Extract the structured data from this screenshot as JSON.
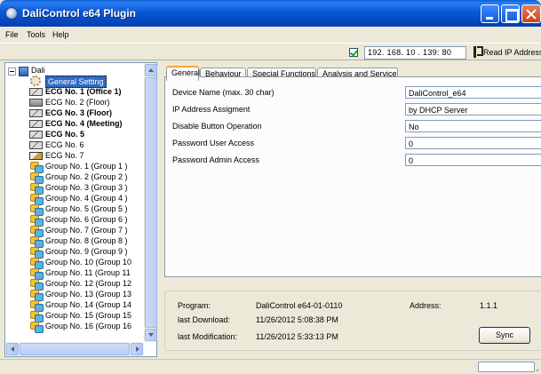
{
  "window": {
    "title": "DaliControl e64 Plugin"
  },
  "menu": {
    "items": [
      "File",
      "Tools",
      "Help"
    ]
  },
  "toolbar": {
    "ip_enabled": true,
    "ip_address": "192. 168. 10 . 139: 80",
    "read_ip_label": "Read IP Address"
  },
  "tree": {
    "root_label": "Dali",
    "items": [
      {
        "label": "General Setting",
        "icon": "gear-icon",
        "selected": true,
        "bold": false
      },
      {
        "label": "ECG No. 1 (Office 1)",
        "icon": "ecg-icon",
        "bold": true
      },
      {
        "label": "ECG No. 2 (Floor)",
        "icon": "ecg-icon",
        "bold": false
      },
      {
        "label": "ECG No. 3 (Floor)",
        "icon": "ecg-icon",
        "bold": true
      },
      {
        "label": "ECG No. 4 (Meeting)",
        "icon": "ecg-icon",
        "bold": true
      },
      {
        "label": "ECG No. 5",
        "icon": "ecg-icon",
        "bold": true
      },
      {
        "label": "ECG No. 6",
        "icon": "ecg-icon",
        "bold": false
      },
      {
        "label": "ECG No. 7",
        "icon": "ecg-warning-icon",
        "bold": false
      },
      {
        "label": "Group No. 1 (Group  1  )",
        "icon": "group-icon",
        "bold": false
      },
      {
        "label": "Group No. 2 (Group  2  )",
        "icon": "group-icon",
        "bold": false
      },
      {
        "label": "Group No. 3 (Group  3  )",
        "icon": "group-icon",
        "bold": false
      },
      {
        "label": "Group No. 4 (Group  4  )",
        "icon": "group-icon",
        "bold": false
      },
      {
        "label": "Group No. 5 (Group  5  )",
        "icon": "group-icon",
        "bold": false
      },
      {
        "label": "Group No. 6 (Group  6  )",
        "icon": "group-icon",
        "bold": false
      },
      {
        "label": "Group No. 7 (Group  7  )",
        "icon": "group-icon",
        "bold": false
      },
      {
        "label": "Group No. 8 (Group  8  )",
        "icon": "group-icon",
        "bold": false
      },
      {
        "label": "Group No. 9 (Group  9  )",
        "icon": "group-icon",
        "bold": false
      },
      {
        "label": "Group No. 10 (Group 10",
        "icon": "group-icon",
        "bold": false
      },
      {
        "label": "Group No. 11 (Group 11",
        "icon": "group-icon",
        "bold": false
      },
      {
        "label": "Group No. 12 (Group 12",
        "icon": "group-icon",
        "bold": false
      },
      {
        "label": "Group No. 13 (Group 13",
        "icon": "group-icon",
        "bold": false
      },
      {
        "label": "Group No. 14 (Group 14",
        "icon": "group-icon",
        "bold": false
      },
      {
        "label": "Group No. 15 (Group 15",
        "icon": "group-icon",
        "bold": false
      },
      {
        "label": "Group No. 16 (Group 16",
        "icon": "group-icon",
        "bold": false
      }
    ]
  },
  "tabs": [
    "General",
    "Behaviour",
    "Special Functions",
    "Analysis and Service"
  ],
  "active_tab": "General",
  "general": {
    "rows": [
      {
        "label": "Device Name (max. 30 char)",
        "value": "DaliControl_e64"
      },
      {
        "label": "IP Address Assigment",
        "value": "by DHCP Server"
      },
      {
        "label": "Disable Button Operation",
        "value": "No"
      },
      {
        "label": "Password User Access",
        "value": "0"
      },
      {
        "label": "Password Admin Access",
        "value": "0"
      }
    ]
  },
  "info": {
    "program_label": "Program:",
    "program_value": "DaliControl  e64-01-0110",
    "address_label": "Address:",
    "address_value": "1.1.1",
    "download_label": "last Download:",
    "download_value": "11/26/2012 5:08:38 PM",
    "modification_label": "last Modification:",
    "modification_value": "11/26/2012 5:33:13 PM",
    "sync_label": "Sync"
  }
}
